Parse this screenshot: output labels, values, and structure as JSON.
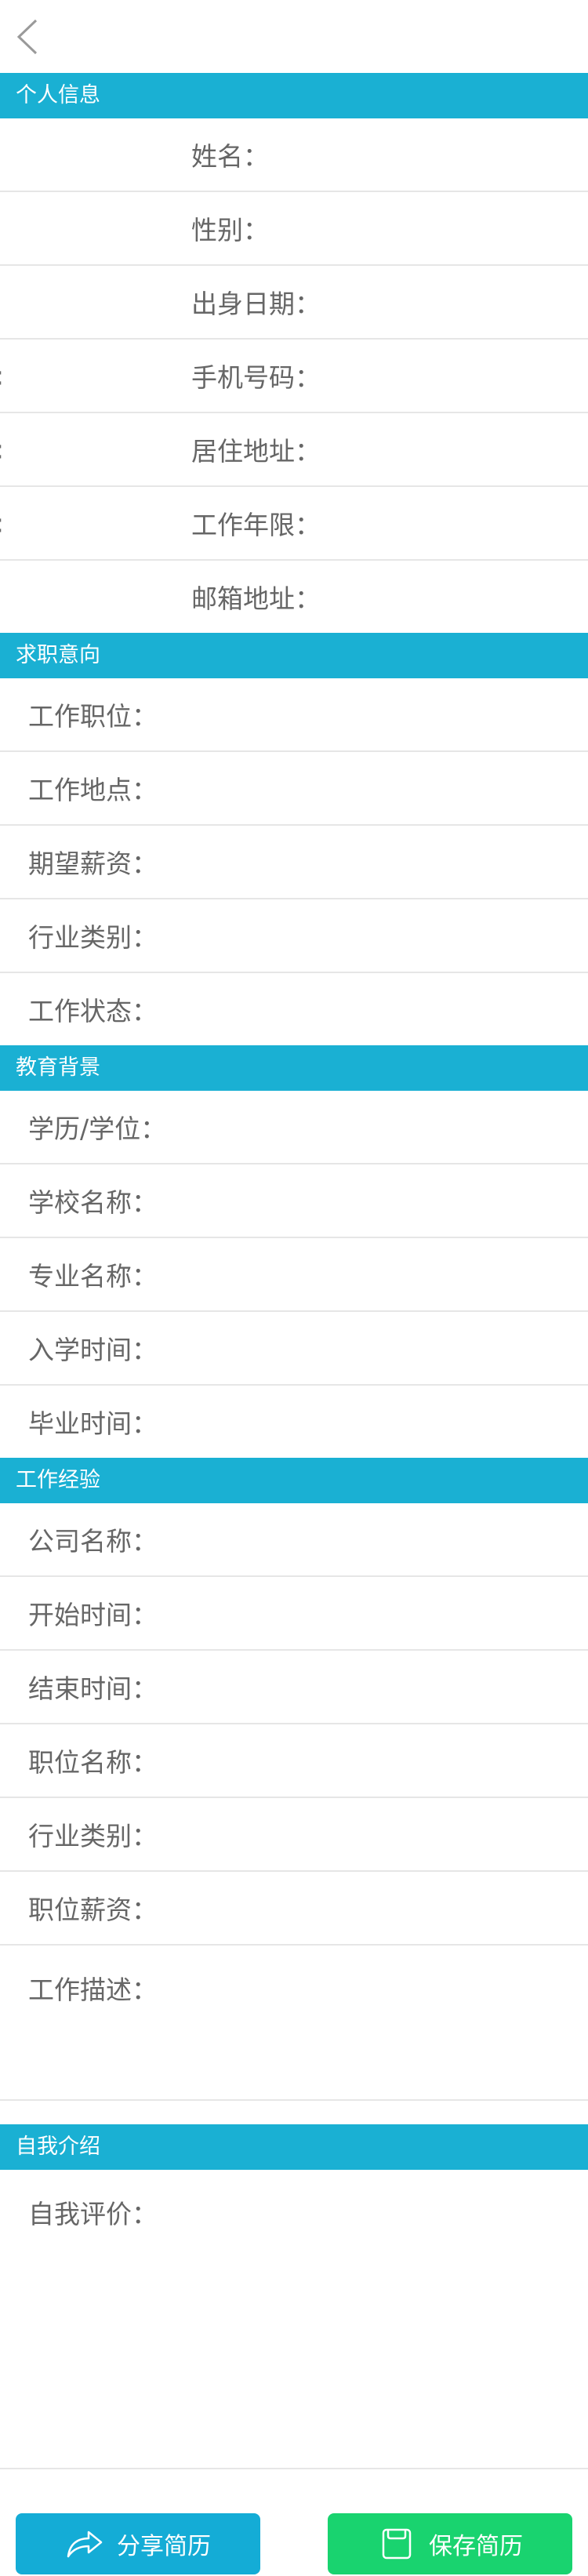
{
  "personal": {
    "header": "个人信息",
    "fields": [
      {
        "label": "姓名：",
        "colon": ""
      },
      {
        "label": "性别：",
        "colon": ""
      },
      {
        "label": "出身日期：",
        "colon": ""
      },
      {
        "label": "手机号码：",
        "colon": ":"
      },
      {
        "label": "居住地址：",
        "colon": ":"
      },
      {
        "label": "工作年限：",
        "colon": ":"
      },
      {
        "label": "邮箱地址：",
        "colon": ""
      }
    ]
  },
  "intention": {
    "header": "求职意向",
    "fields": [
      "工作职位：",
      "工作地点：",
      "期望薪资：",
      "行业类别：",
      "工作状态："
    ]
  },
  "education": {
    "header": "教育背景",
    "fields": [
      "学历/学位：",
      "学校名称：",
      "专业名称：",
      "入学时间：",
      "毕业时间："
    ]
  },
  "experience": {
    "header": "工作经验",
    "fields": [
      "公司名称：",
      "开始时间：",
      "结束时间：",
      "职位名称：",
      "行业类别：",
      "职位薪资：",
      "工作描述："
    ]
  },
  "intro": {
    "header": "自我介绍",
    "fields": [
      "自我评价："
    ]
  },
  "footer": {
    "share_label": "分享简历",
    "save_label": "保存简历"
  },
  "colors": {
    "header_bg": "#1ab0d3",
    "share_bg": "#14acd6",
    "save_bg": "#19d36f"
  }
}
